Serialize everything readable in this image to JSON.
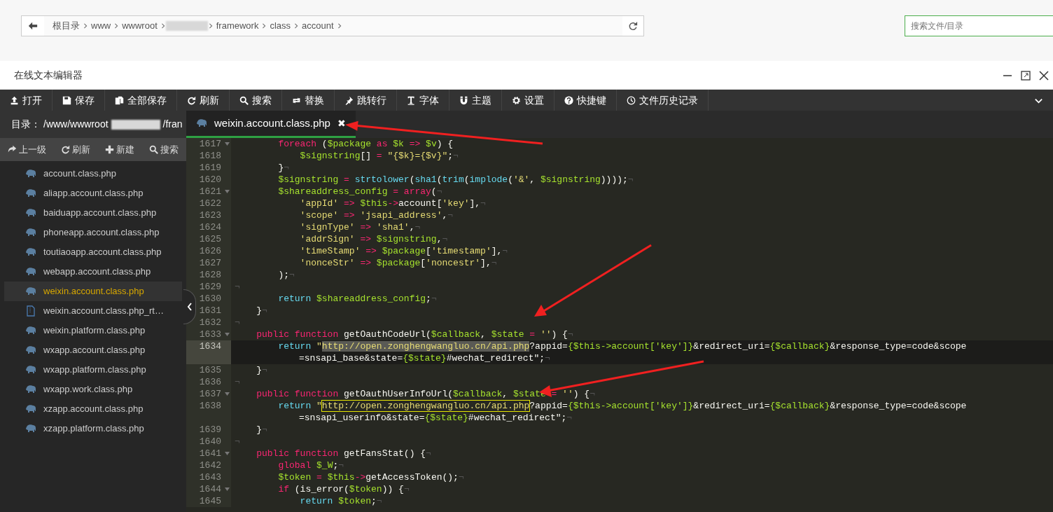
{
  "address_bar": {
    "crumbs": [
      {
        "kind": "text",
        "label": "根目录"
      },
      {
        "kind": "text",
        "label": "www"
      },
      {
        "kind": "text",
        "label": "wwwroot"
      },
      {
        "kind": "redacted"
      },
      {
        "kind": "text",
        "label": "framework"
      },
      {
        "kind": "text",
        "label": "class"
      },
      {
        "kind": "text",
        "label": "account"
      }
    ]
  },
  "search": {
    "placeholder": "搜索文件/目录"
  },
  "editor_window": {
    "title": "在线文本编辑器"
  },
  "toolbar": [
    {
      "label": "打开"
    },
    {
      "label": "保存"
    },
    {
      "label": "全部保存"
    },
    {
      "label": "刷新"
    },
    {
      "label": "搜索"
    },
    {
      "label": "替换"
    },
    {
      "label": "跳转行"
    },
    {
      "label": "字体"
    },
    {
      "label": "主题"
    },
    {
      "label": "设置"
    },
    {
      "label": "快捷键"
    },
    {
      "label": "文件历史记录"
    }
  ],
  "sidebar": {
    "dir_label": "目录：",
    "path_start": "/www/wwwroot",
    "path_end": "/fran",
    "actions": [
      {
        "label": "上一级"
      },
      {
        "label": "刷新"
      },
      {
        "label": "新建"
      },
      {
        "label": "搜索"
      }
    ],
    "files": [
      {
        "name": "account.class.php",
        "kind": "php",
        "selected": false
      },
      {
        "name": "aliapp.account.class.php",
        "kind": "php",
        "selected": false
      },
      {
        "name": "baiduapp.account.class.php",
        "kind": "php",
        "selected": false
      },
      {
        "name": "phoneapp.account.class.php",
        "kind": "php",
        "selected": false
      },
      {
        "name": "toutiaoapp.account.class.php",
        "kind": "php",
        "selected": false
      },
      {
        "name": "webapp.account.class.php",
        "kind": "php",
        "selected": false
      },
      {
        "name": "weixin.account.class.php",
        "kind": "php",
        "selected": true
      },
      {
        "name": "weixin.account.class.php_rt…",
        "kind": "text",
        "selected": false
      },
      {
        "name": "weixin.platform.class.php",
        "kind": "php",
        "selected": false
      },
      {
        "name": "wxapp.account.class.php",
        "kind": "php",
        "selected": false
      },
      {
        "name": "wxapp.platform.class.php",
        "kind": "php",
        "selected": false
      },
      {
        "name": "wxapp.work.class.php",
        "kind": "php",
        "selected": false
      },
      {
        "name": "xzapp.account.class.php",
        "kind": "php",
        "selected": false
      },
      {
        "name": "xzapp.platform.class.php",
        "kind": "php",
        "selected": false
      }
    ]
  },
  "tabs": [
    {
      "label": "weixin.account.class.php",
      "close": "✖",
      "selected": true
    }
  ],
  "code": {
    "lines": [
      {
        "num": "1617",
        "fold": true,
        "active": false,
        "tokens": [
          {
            "kind": "k",
            "text": "        foreach"
          },
          {
            "kind": "p",
            "text": " ("
          },
          {
            "kind": "v",
            "text": "$package "
          },
          {
            "kind": "k",
            "text": "as "
          },
          {
            "kind": "v",
            "text": "$k "
          },
          {
            "kind": "k",
            "text": "=> "
          },
          {
            "kind": "v",
            "text": "$v"
          },
          {
            "kind": "p",
            "text": ") {"
          }
        ]
      },
      {
        "num": "1618",
        "fold": false,
        "active": false,
        "tokens": [
          {
            "kind": "v",
            "text": "            $signstring"
          },
          {
            "kind": "p",
            "text": "[] "
          },
          {
            "kind": "k",
            "text": "= "
          },
          {
            "kind": "s",
            "text": "\"{$k}={$v}\""
          },
          {
            "kind": "p",
            "text": ";"
          },
          {
            "kind": "e",
            "text": "¬"
          }
        ]
      },
      {
        "num": "1619",
        "fold": false,
        "active": false,
        "tokens": [
          {
            "kind": "p",
            "text": "        }"
          },
          {
            "kind": "e",
            "text": "¬"
          }
        ]
      },
      {
        "num": "1620",
        "fold": false,
        "active": false,
        "tokens": [
          {
            "kind": "v",
            "text": "        $signstring "
          },
          {
            "kind": "k",
            "text": "= "
          },
          {
            "kind": "f",
            "text": "strtolower"
          },
          {
            "kind": "p",
            "text": "("
          },
          {
            "kind": "f",
            "text": "sha1"
          },
          {
            "kind": "p",
            "text": "("
          },
          {
            "kind": "f",
            "text": "trim"
          },
          {
            "kind": "p",
            "text": "("
          },
          {
            "kind": "f",
            "text": "implode"
          },
          {
            "kind": "p",
            "text": "("
          },
          {
            "kind": "s",
            "text": "'&'"
          },
          {
            "kind": "p",
            "text": ", "
          },
          {
            "kind": "v",
            "text": "$signstring"
          },
          {
            "kind": "p",
            "text": "))));"
          },
          {
            "kind": "e",
            "text": "¬"
          }
        ]
      },
      {
        "num": "1621",
        "fold": true,
        "active": false,
        "tokens": [
          {
            "kind": "v",
            "text": "        $shareaddress_config "
          },
          {
            "kind": "k",
            "text": "= array"
          },
          {
            "kind": "p",
            "text": "("
          },
          {
            "kind": "e",
            "text": "¬"
          }
        ]
      },
      {
        "num": "1622",
        "fold": false,
        "active": false,
        "tokens": [
          {
            "kind": "s",
            "text": "            'appId' "
          },
          {
            "kind": "k",
            "text": "=> "
          },
          {
            "kind": "v",
            "text": "$this"
          },
          {
            "kind": "k",
            "text": "->"
          },
          {
            "kind": "p",
            "text": "account["
          },
          {
            "kind": "s",
            "text": "'key'"
          },
          {
            "kind": "p",
            "text": "],"
          },
          {
            "kind": "e",
            "text": "¬"
          }
        ]
      },
      {
        "num": "1623",
        "fold": false,
        "active": false,
        "tokens": [
          {
            "kind": "s",
            "text": "            'scope' "
          },
          {
            "kind": "k",
            "text": "=> "
          },
          {
            "kind": "s",
            "text": "'jsapi_address'"
          },
          {
            "kind": "p",
            "text": ","
          },
          {
            "kind": "e",
            "text": "¬"
          }
        ]
      },
      {
        "num": "1624",
        "fold": false,
        "active": false,
        "tokens": [
          {
            "kind": "s",
            "text": "            'signType' "
          },
          {
            "kind": "k",
            "text": "=> "
          },
          {
            "kind": "s",
            "text": "'sha1'"
          },
          {
            "kind": "p",
            "text": ","
          },
          {
            "kind": "e",
            "text": "¬"
          }
        ]
      },
      {
        "num": "1625",
        "fold": false,
        "active": false,
        "tokens": [
          {
            "kind": "s",
            "text": "            'addrSign' "
          },
          {
            "kind": "k",
            "text": "=> "
          },
          {
            "kind": "v",
            "text": "$signstring"
          },
          {
            "kind": "p",
            "text": ","
          },
          {
            "kind": "e",
            "text": "¬"
          }
        ]
      },
      {
        "num": "1626",
        "fold": false,
        "active": false,
        "tokens": [
          {
            "kind": "s",
            "text": "            'timeStamp' "
          },
          {
            "kind": "k",
            "text": "=> "
          },
          {
            "kind": "v",
            "text": "$package"
          },
          {
            "kind": "p",
            "text": "["
          },
          {
            "kind": "s",
            "text": "'timestamp'"
          },
          {
            "kind": "p",
            "text": "],"
          },
          {
            "kind": "e",
            "text": "¬"
          }
        ]
      },
      {
        "num": "1627",
        "fold": false,
        "active": false,
        "tokens": [
          {
            "kind": "s",
            "text": "            'nonceStr' "
          },
          {
            "kind": "k",
            "text": "=> "
          },
          {
            "kind": "v",
            "text": "$package"
          },
          {
            "kind": "p",
            "text": "["
          },
          {
            "kind": "s",
            "text": "'noncestr'"
          },
          {
            "kind": "p",
            "text": "],"
          },
          {
            "kind": "e",
            "text": "¬"
          }
        ]
      },
      {
        "num": "1628",
        "fold": false,
        "active": false,
        "tokens": [
          {
            "kind": "p",
            "text": "        );"
          },
          {
            "kind": "e",
            "text": "¬"
          }
        ]
      },
      {
        "num": "1629",
        "fold": false,
        "active": false,
        "tokens": [
          {
            "kind": "e",
            "text": "¬"
          }
        ]
      },
      {
        "num": "1630",
        "fold": false,
        "active": false,
        "tokens": [
          {
            "kind": "f",
            "text": "        return "
          },
          {
            "kind": "v",
            "text": "$shareaddress_config"
          },
          {
            "kind": "p",
            "text": ";"
          },
          {
            "kind": "e",
            "text": "¬"
          }
        ]
      },
      {
        "num": "1631",
        "fold": false,
        "active": false,
        "tokens": [
          {
            "kind": "p",
            "text": "    }"
          },
          {
            "kind": "e",
            "text": "¬"
          }
        ]
      },
      {
        "num": "1632",
        "fold": false,
        "active": false,
        "tokens": [
          {
            "kind": "e",
            "text": "¬"
          }
        ]
      },
      {
        "num": "1633",
        "fold": true,
        "active": false,
        "tokens": [
          {
            "kind": "k",
            "text": "    public function"
          },
          {
            "kind": "p",
            "text": " getOauthCodeUrl("
          },
          {
            "kind": "v",
            "text": "$callback"
          },
          {
            "kind": "p",
            "text": ", "
          },
          {
            "kind": "v",
            "text": "$state "
          },
          {
            "kind": "k",
            "text": "= "
          },
          {
            "kind": "s",
            "text": "''"
          },
          {
            "kind": "p",
            "text": ") {"
          },
          {
            "kind": "e",
            "text": "¬"
          }
        ]
      },
      {
        "num": "1634",
        "fold": false,
        "active": true,
        "tokens": [
          {
            "kind": "f",
            "text": "        return "
          },
          {
            "kind": "s",
            "text": "\""
          },
          {
            "kind": "selection",
            "text": "http://open.zonghengwangluo.cn/api.php"
          },
          {
            "kind": "p",
            "text": "?appid="
          },
          {
            "kind": "v",
            "text": "{$this->account['key']}"
          },
          {
            "kind": "p",
            "text": "&redirect_uri="
          },
          {
            "kind": "v",
            "text": "{$callback}"
          },
          {
            "kind": "p",
            "text": "&response_type=code&scope"
          }
        ],
        "wrap": [
          {
            "kind": "p",
            "text": "=snsapi_base&state="
          },
          {
            "kind": "v",
            "text": "{$state}"
          },
          {
            "kind": "p",
            "text": "#wechat_redirect\";"
          },
          {
            "kind": "e",
            "text": "¬"
          }
        ]
      },
      {
        "num": "1635",
        "fold": false,
        "active": false,
        "tokens": [
          {
            "kind": "p",
            "text": "    }"
          },
          {
            "kind": "e",
            "text": "¬"
          }
        ]
      },
      {
        "num": "1636",
        "fold": false,
        "active": false,
        "tokens": [
          {
            "kind": "e",
            "text": "¬"
          }
        ]
      },
      {
        "num": "1637",
        "fold": true,
        "active": false,
        "tokens": [
          {
            "kind": "k",
            "text": "    public function"
          },
          {
            "kind": "p",
            "text": " getOauthUserInfoUrl("
          },
          {
            "kind": "v",
            "text": "$callback"
          },
          {
            "kind": "p",
            "text": ", "
          },
          {
            "kind": "v",
            "text": "$state "
          },
          {
            "kind": "k",
            "text": "= "
          },
          {
            "kind": "s",
            "text": "''"
          },
          {
            "kind": "p",
            "text": ") {"
          },
          {
            "kind": "e",
            "text": "¬"
          }
        ]
      },
      {
        "num": "1638",
        "fold": false,
        "active": false,
        "tokens": [
          {
            "kind": "f",
            "text": "        return "
          },
          {
            "kind": "s",
            "text": "\""
          },
          {
            "kind": "match",
            "text": "http://open.zonghengwangluo.cn/api.php"
          },
          {
            "kind": "p",
            "text": "?appid="
          },
          {
            "kind": "v",
            "text": "{$this->account['key']}"
          },
          {
            "kind": "p",
            "text": "&redirect_uri="
          },
          {
            "kind": "v",
            "text": "{$callback}"
          },
          {
            "kind": "p",
            "text": "&response_type=code&scope"
          }
        ],
        "wrap": [
          {
            "kind": "p",
            "text": "=snsapi_userinfo&state="
          },
          {
            "kind": "v",
            "text": "{$state}"
          },
          {
            "kind": "p",
            "text": "#wechat_redirect\";"
          },
          {
            "kind": "e",
            "text": "¬"
          }
        ]
      },
      {
        "num": "1639",
        "fold": false,
        "active": false,
        "tokens": [
          {
            "kind": "p",
            "text": "    }"
          },
          {
            "kind": "e",
            "text": "¬"
          }
        ]
      },
      {
        "num": "1640",
        "fold": false,
        "active": false,
        "tokens": [
          {
            "kind": "e",
            "text": "¬"
          }
        ]
      },
      {
        "num": "1641",
        "fold": true,
        "active": false,
        "tokens": [
          {
            "kind": "k",
            "text": "    public function"
          },
          {
            "kind": "p",
            "text": " getFansStat() {"
          },
          {
            "kind": "e",
            "text": "¬"
          }
        ]
      },
      {
        "num": "1642",
        "fold": false,
        "active": false,
        "tokens": [
          {
            "kind": "k",
            "text": "        global "
          },
          {
            "kind": "v",
            "text": "$_W"
          },
          {
            "kind": "p",
            "text": ";"
          },
          {
            "kind": "e",
            "text": "¬"
          }
        ]
      },
      {
        "num": "1643",
        "fold": false,
        "active": false,
        "tokens": [
          {
            "kind": "v",
            "text": "        $token "
          },
          {
            "kind": "k",
            "text": "= "
          },
          {
            "kind": "v",
            "text": "$this"
          },
          {
            "kind": "k",
            "text": "->"
          },
          {
            "kind": "p",
            "text": "getAccessToken();"
          },
          {
            "kind": "e",
            "text": "¬"
          }
        ]
      },
      {
        "num": "1644",
        "fold": true,
        "active": false,
        "tokens": [
          {
            "kind": "k",
            "text": "        if"
          },
          {
            "kind": "p",
            "text": " (is_error("
          },
          {
            "kind": "v",
            "text": "$token"
          },
          {
            "kind": "p",
            "text": ")) {"
          },
          {
            "kind": "e",
            "text": "¬"
          }
        ]
      },
      {
        "num": "1645",
        "fold": false,
        "active": false,
        "tokens": [
          {
            "kind": "f",
            "text": "            return "
          },
          {
            "kind": "v",
            "text": "$token"
          },
          {
            "kind": "p",
            "text": ";"
          },
          {
            "kind": "e",
            "text": "¬"
          }
        ]
      }
    ]
  }
}
